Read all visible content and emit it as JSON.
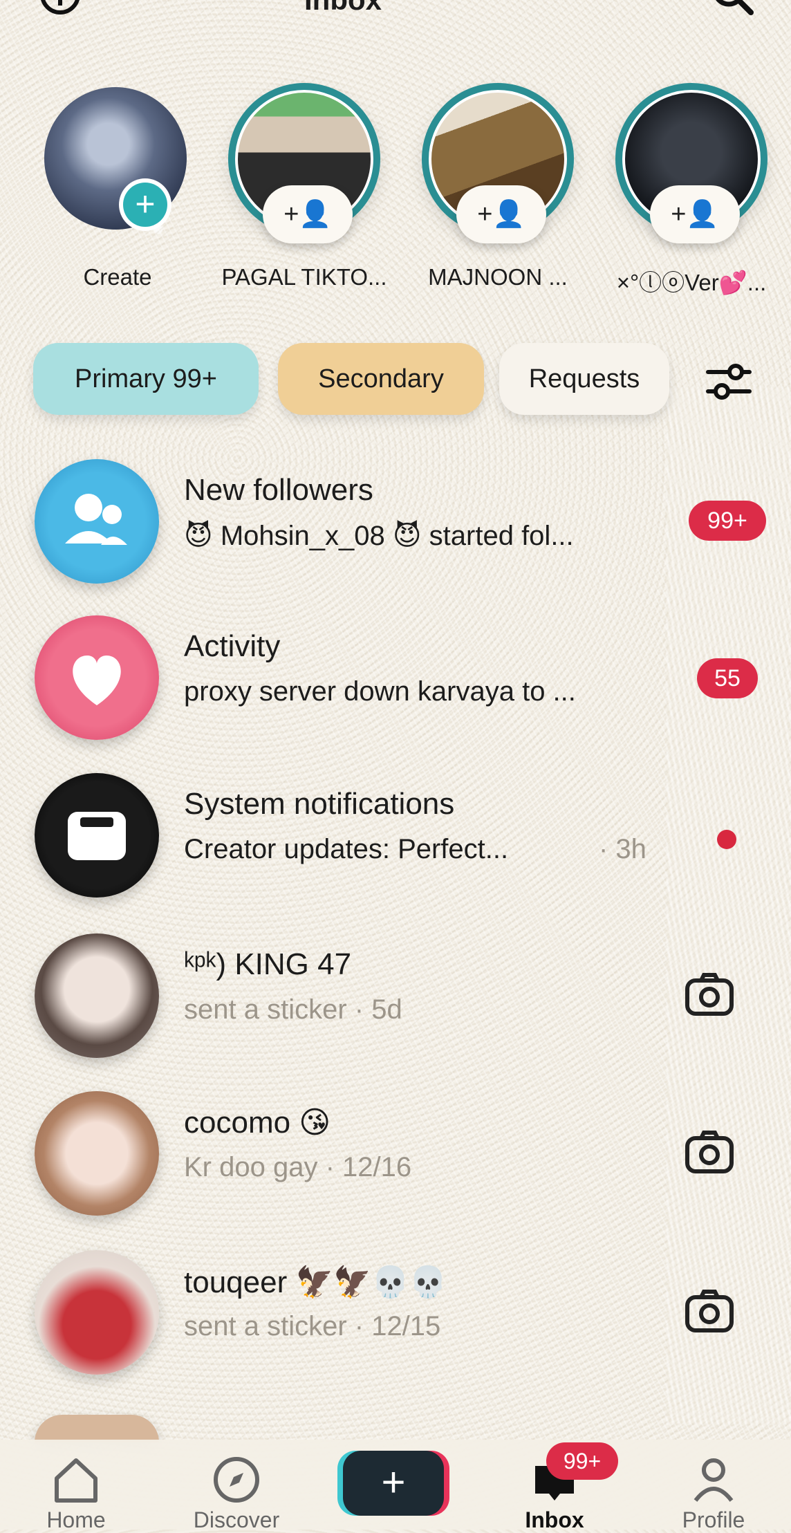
{
  "header": {
    "title": "Inbox",
    "add_icon": "add-circle-icon",
    "search_icon": "search-icon"
  },
  "stories": [
    {
      "label": "Create",
      "icon": "plus-icon"
    },
    {
      "label": "PAGAL TIKTO...",
      "icon": "add-friend-icon"
    },
    {
      "label": "MAJNOON ...",
      "icon": "add-friend-icon"
    },
    {
      "label": "×°ⓛⓞVer💕...",
      "icon": "add-friend-icon"
    }
  ],
  "tabs": {
    "primary": "Primary 99+",
    "secondary": "Secondary",
    "requests": "Requests"
  },
  "rows": [
    {
      "name": "New followers",
      "sub": "😈 Mohsin_x_08 😈 started fol...",
      "badge": "99+"
    },
    {
      "name": "Activity",
      "sub": "proxy server down karvaya to ...",
      "badge": "55"
    },
    {
      "name": "System notifications",
      "sub": "Creator updates: Perfect...",
      "time": "· 3h"
    },
    {
      "name": "ᵏᵖᵏ) KING 47",
      "sub": "sent a sticker · 5d"
    },
    {
      "name": "cocomo 😘",
      "sub": "Kr doo gay · 12/16"
    },
    {
      "name": "touqeer 🦅🦅💀💀",
      "sub": "sent a sticker · 12/15"
    }
  ],
  "nav": {
    "home": "Home",
    "discover": "Discover",
    "inbox": "Inbox",
    "profile": "Profile",
    "inbox_badge": "99+"
  },
  "colors": {
    "badge": "#dc2c48",
    "teal": "#2bb0b4",
    "primary_tab": "#a9dfe0",
    "secondary_tab": "#f0cf96"
  }
}
